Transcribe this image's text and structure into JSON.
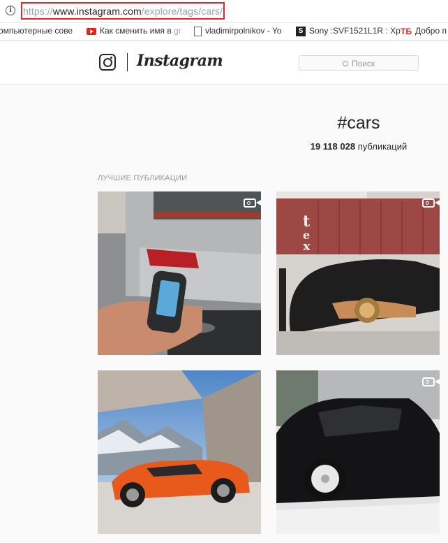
{
  "browser": {
    "url_prefix": "https://",
    "url_host": "www.instagram.com",
    "url_path": "/explore/tags/cars/",
    "bookmarks": [
      {
        "label": "омпьютерные сове",
        "icon": "folder-icon"
      },
      {
        "label": "Как сменить имя в ",
        "fade": "gr",
        "icon": "youtube-icon"
      },
      {
        "label": "vladimirpolnikov - Yo",
        "icon": "document-icon"
      },
      {
        "label": "Sony :SVF1521L1R : Xp",
        "icon": "sony-icon",
        "icon_text": "S"
      },
      {
        "label": "Добро п",
        "icon": "tb-icon",
        "icon_text": "ТБ"
      }
    ]
  },
  "header": {
    "wordmark": "Instagram",
    "search_placeholder": "Поиск"
  },
  "tag": {
    "hashtag": "#cars",
    "count": "19 118 028",
    "count_suffix": " публикаций"
  },
  "section": {
    "title": "ЛУЧШИЕ ПУБЛИКАЦИИ"
  },
  "posts": [
    {
      "name": "post-bmw-key",
      "video": true
    },
    {
      "name": "post-covered-car",
      "video": true
    },
    {
      "name": "post-orange-mclaren",
      "video": false
    },
    {
      "name": "post-black-car-drift",
      "video": true
    }
  ],
  "colors": {
    "highlight": "#e0262b",
    "text": "#262626",
    "muted": "#999999"
  }
}
